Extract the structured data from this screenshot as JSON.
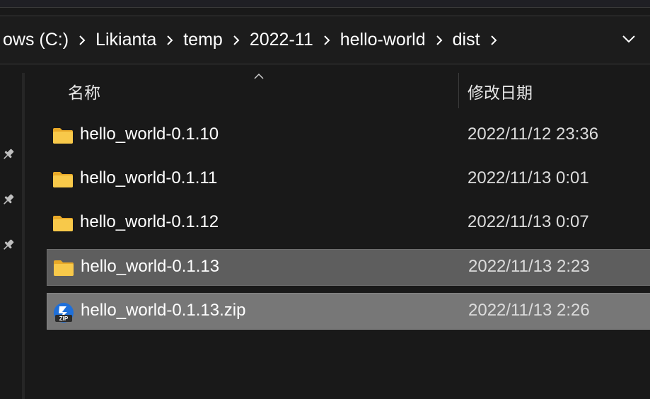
{
  "breadcrumb": {
    "items": [
      "ows (C:)",
      "Likianta",
      "temp",
      "2022-11",
      "hello-world",
      "dist"
    ]
  },
  "columns": {
    "name": "名称",
    "date_modified": "修改日期"
  },
  "files": [
    {
      "name": "hello_world-0.1.10",
      "date": "2022/11/12 23:36",
      "type": "folder-icon",
      "selected": false
    },
    {
      "name": "hello_world-0.1.11",
      "date": "2022/11/13 0:01",
      "type": "folder-icon",
      "selected": false
    },
    {
      "name": "hello_world-0.1.12",
      "date": "2022/11/13 0:07",
      "type": "folder-icon",
      "selected": false
    },
    {
      "name": "hello_world-0.1.13",
      "date": "2022/11/13 2:23",
      "type": "folder-icon",
      "selected": true
    },
    {
      "name": "hello_world-0.1.13.zip",
      "date": "2022/11/13 2:26",
      "type": "zip-archive-icon",
      "selected": true
    }
  ],
  "colors": {
    "background": "#191919",
    "selection": "#5e5e5e",
    "selection_hover": "#777777",
    "folder": "#f8c94a",
    "zip_badge": "#1e6fd9"
  }
}
